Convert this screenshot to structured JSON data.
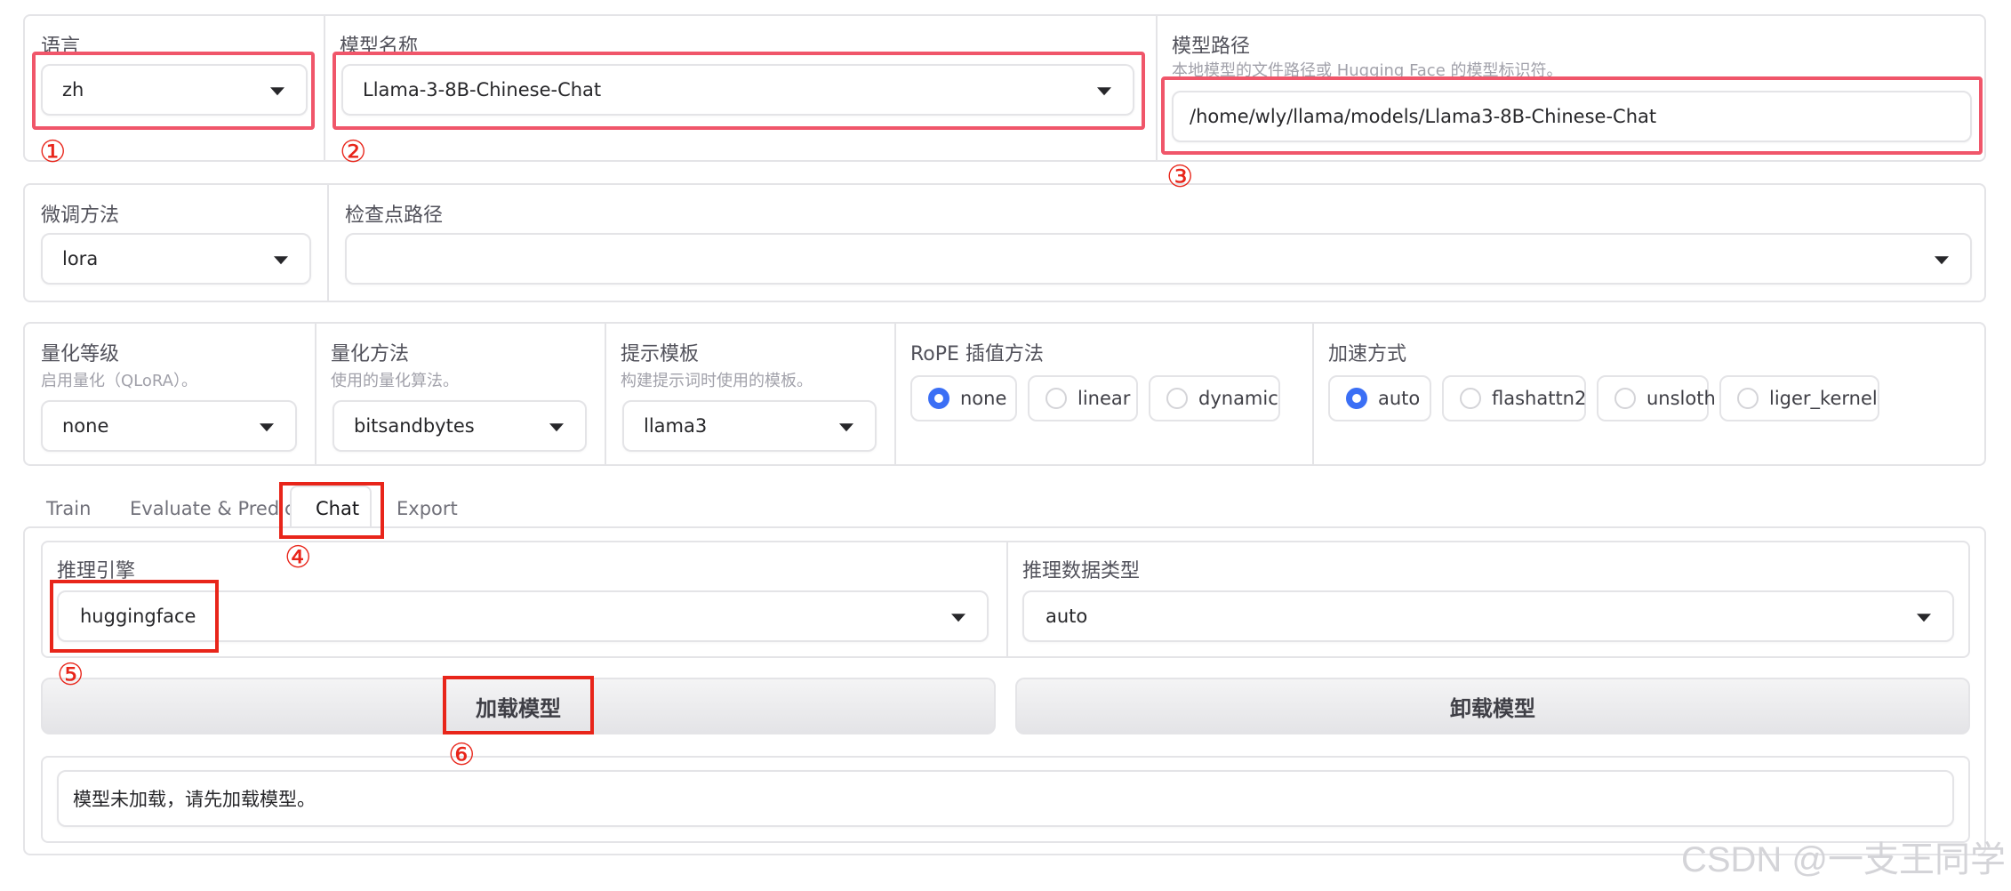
{
  "colors": {
    "accent": "#3b6ff5",
    "highlight_pink": "#f0566a",
    "highlight_red": "#e8251a",
    "annotation": "#e8251a"
  },
  "row1": {
    "language": {
      "label": "语言",
      "value": "zh"
    },
    "model_name": {
      "label": "模型名称",
      "value": "Llama-3-8B-Chinese-Chat"
    },
    "model_path": {
      "label": "模型路径",
      "desc": "本地模型的文件路径或 Hugging Face 的模型标识符。",
      "value": "/home/wly/llama/models/Llama3-8B-Chinese-Chat"
    }
  },
  "row2": {
    "finetune": {
      "label": "微调方法",
      "value": "lora"
    },
    "checkpoint": {
      "label": "检查点路径",
      "value": ""
    }
  },
  "row3": {
    "quant_bit": {
      "label": "量化等级",
      "desc": "启用量化（QLoRA）。",
      "value": "none"
    },
    "quant_method": {
      "label": "量化方法",
      "desc": "使用的量化算法。",
      "value": "bitsandbytes"
    },
    "template": {
      "label": "提示模板",
      "desc": "构建提示词时使用的模板。",
      "value": "llama3"
    },
    "rope": {
      "label": "RoPE 插值方法",
      "options": [
        "none",
        "linear",
        "dynamic"
      ],
      "selected": "none"
    },
    "booster": {
      "label": "加速方式",
      "options": [
        "auto",
        "flashattn2",
        "unsloth",
        "liger_kernel"
      ],
      "selected": "auto"
    }
  },
  "tabs": [
    "Train",
    "Evaluate & Predict",
    "Chat",
    "Export"
  ],
  "active_tab": "Chat",
  "chat": {
    "infer_backend": {
      "label": "推理引擎",
      "value": "huggingface"
    },
    "infer_dtype": {
      "label": "推理数据类型",
      "value": "auto"
    },
    "load_button": "加载模型",
    "unload_button": "卸载模型",
    "info_box": "模型未加载，请先加载模型。"
  },
  "annotations": [
    "①",
    "②",
    "③",
    "④",
    "⑤",
    "⑥"
  ],
  "watermark": "CSDN @一支王同学"
}
